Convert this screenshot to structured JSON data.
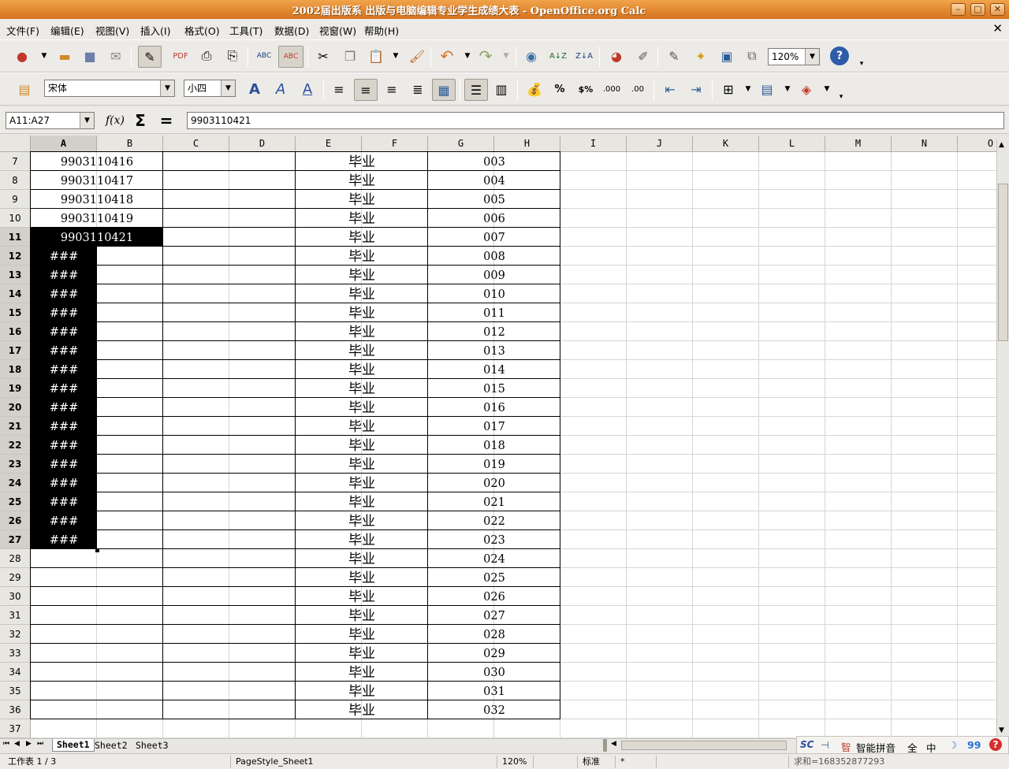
{
  "window": {
    "title": "2002届出版系 出版与电脑编辑专业学生成绩大表 - OpenOffice.org Calc"
  },
  "menu": [
    "文件(F)",
    "编辑(E)",
    "视图(V)",
    "插入(I)",
    "格式(O)",
    "工具(T)",
    "数据(D)",
    "视窗(W)",
    "帮助(H)"
  ],
  "toolbar": {
    "zoom": "120%"
  },
  "format_bar": {
    "font_name": "宋体",
    "font_size": "小四"
  },
  "formula_bar": {
    "name_box": "A11:A27",
    "content": "9903110421"
  },
  "columns": [
    "A",
    "B",
    "C",
    "D",
    "E",
    "F",
    "G",
    "H",
    "I",
    "J",
    "K",
    "L",
    "M",
    "N",
    "O"
  ],
  "rows": [
    {
      "n": "7",
      "a": "9903110416",
      "e": "毕业",
      "g": "003"
    },
    {
      "n": "8",
      "a": "9903110417",
      "e": "毕业",
      "g": "004"
    },
    {
      "n": "9",
      "a": "9903110418",
      "e": "毕业",
      "g": "005"
    },
    {
      "n": "10",
      "a": "9903110419",
      "e": "毕业",
      "g": "006"
    },
    {
      "n": "11",
      "a": "9903110421",
      "e": "毕业",
      "g": "007"
    },
    {
      "n": "12",
      "a": "###",
      "e": "毕业",
      "g": "008"
    },
    {
      "n": "13",
      "a": "###",
      "e": "毕业",
      "g": "009"
    },
    {
      "n": "14",
      "a": "###",
      "e": "毕业",
      "g": "010"
    },
    {
      "n": "15",
      "a": "###",
      "e": "毕业",
      "g": "011"
    },
    {
      "n": "16",
      "a": "###",
      "e": "毕业",
      "g": "012"
    },
    {
      "n": "17",
      "a": "###",
      "e": "毕业",
      "g": "013"
    },
    {
      "n": "18",
      "a": "###",
      "e": "毕业",
      "g": "014"
    },
    {
      "n": "19",
      "a": "###",
      "e": "毕业",
      "g": "015"
    },
    {
      "n": "20",
      "a": "###",
      "e": "毕业",
      "g": "016"
    },
    {
      "n": "21",
      "a": "###",
      "e": "毕业",
      "g": "017"
    },
    {
      "n": "22",
      "a": "###",
      "e": "毕业",
      "g": "018"
    },
    {
      "n": "23",
      "a": "###",
      "e": "毕业",
      "g": "019"
    },
    {
      "n": "24",
      "a": "###",
      "e": "毕业",
      "g": "020"
    },
    {
      "n": "25",
      "a": "###",
      "e": "毕业",
      "g": "021"
    },
    {
      "n": "26",
      "a": "###",
      "e": "毕业",
      "g": "022"
    },
    {
      "n": "27",
      "a": "###",
      "e": "毕业",
      "g": "023"
    },
    {
      "n": "28",
      "a": "",
      "e": "毕业",
      "g": "024"
    },
    {
      "n": "29",
      "a": "",
      "e": "毕业",
      "g": "025"
    },
    {
      "n": "30",
      "a": "",
      "e": "毕业",
      "g": "026"
    },
    {
      "n": "31",
      "a": "",
      "e": "毕业",
      "g": "027"
    },
    {
      "n": "32",
      "a": "",
      "e": "毕业",
      "g": "028"
    },
    {
      "n": "33",
      "a": "",
      "e": "毕业",
      "g": "029"
    },
    {
      "n": "34",
      "a": "",
      "e": "毕业",
      "g": "030"
    },
    {
      "n": "35",
      "a": "",
      "e": "毕业",
      "g": "031"
    },
    {
      "n": "36",
      "a": "",
      "e": "毕业",
      "g": "032"
    },
    {
      "n": "37",
      "a": "",
      "e": "",
      "g": ""
    }
  ],
  "sheet_tabs": [
    "Sheet1",
    "Sheet2",
    "Sheet3"
  ],
  "status": {
    "sheet_info": "工作表 1 / 3",
    "page_style": "PageStyle_Sheet1",
    "zoom": "120%",
    "mode": "标准",
    "modified": "*",
    "sum": "求和=168352877293"
  },
  "ime": {
    "mode": "智能拼音",
    "width": "全",
    "lang": "中"
  }
}
